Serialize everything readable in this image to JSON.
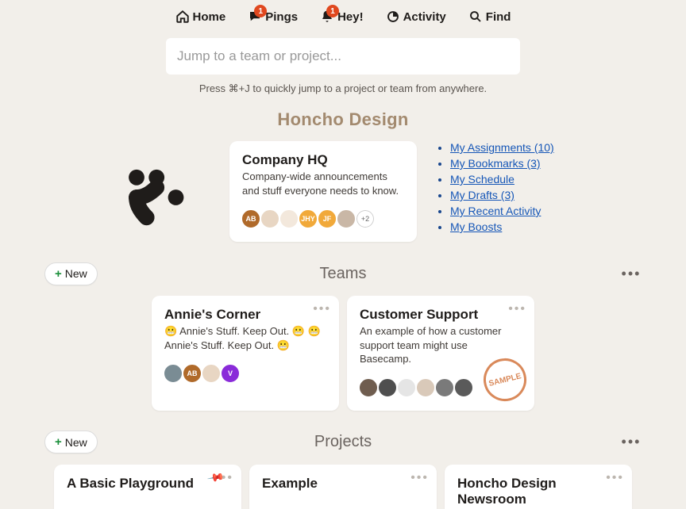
{
  "nav": {
    "home": "Home",
    "pings": "Pings",
    "pings_badge": "1",
    "hey": "Hey!",
    "hey_badge": "1",
    "activity": "Activity",
    "find": "Find"
  },
  "jump": {
    "placeholder": "Jump to a team or project...",
    "hint": "Press ⌘+J to quickly jump to a project or team from anywhere."
  },
  "org": {
    "name": "Honcho Design"
  },
  "hq": {
    "title": "Company HQ",
    "desc": "Company-wide announcements and stuff everyone needs to know.",
    "avatars": [
      {
        "label": "AB",
        "bg": "#b06a2a"
      },
      {
        "label": "",
        "bg": "#e8d6c3"
      },
      {
        "label": "",
        "bg": "#f3e8dc"
      },
      {
        "label": "JHY",
        "bg": "#f1a93a"
      },
      {
        "label": "JF",
        "bg": "#f1a93a"
      },
      {
        "label": "",
        "bg": "#c9b7a6"
      }
    ],
    "more": "+2"
  },
  "links": [
    "My Assignments (10)",
    "My Bookmarks (3)",
    "My Schedule",
    "My Drafts (3)",
    "My Recent Activity",
    "My Boosts"
  ],
  "buttons": {
    "new": "New"
  },
  "teams": {
    "title": "Teams",
    "cards": [
      {
        "title": "Annie's Corner",
        "desc": "😬 Annie's Stuff. Keep Out. 😬 😬 Annie's Stuff. Keep Out. 😬",
        "avatars": [
          {
            "label": "",
            "bg": "#7a8c94"
          },
          {
            "label": "AB",
            "bg": "#b06a2a"
          },
          {
            "label": "",
            "bg": "#e8d6c3"
          },
          {
            "label": "V",
            "bg": "#8a2bd9"
          }
        ]
      },
      {
        "title": "Customer Support",
        "desc": "An example of how a customer support team might use Basecamp.",
        "sample": "SAMPLE",
        "avatars": [
          {
            "label": "",
            "bg": "#6f5d4f"
          },
          {
            "label": "",
            "bg": "#4f4f4f"
          },
          {
            "label": "",
            "bg": "#e5e5e5"
          },
          {
            "label": "",
            "bg": "#d9c9b9"
          },
          {
            "label": "",
            "bg": "#7a7a7a"
          },
          {
            "label": "",
            "bg": "#5a5a5a"
          }
        ]
      }
    ]
  },
  "projects": {
    "title": "Projects",
    "cards": [
      {
        "title": "A Basic Playground",
        "pinned": true
      },
      {
        "title": "Example"
      },
      {
        "title": "Honcho Design Newsroom"
      }
    ]
  }
}
